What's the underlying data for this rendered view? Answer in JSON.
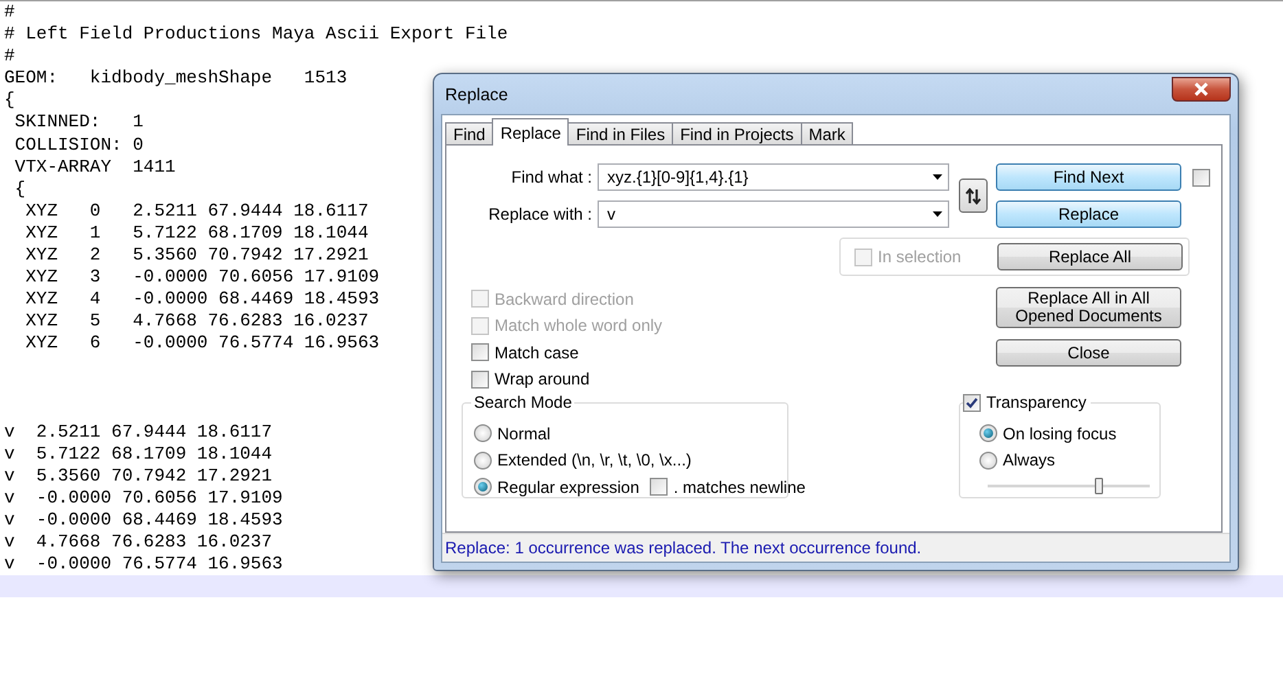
{
  "editor": {
    "sections": [
      {
        "lines": [
          "#",
          "# Left Field Productions Maya Ascii Export File",
          "#",
          "GEOM:   kidbody_meshShape   1513",
          "{",
          " SKINNED:   1",
          " COLLISION: 0",
          " VTX-ARRAY  1411",
          " {",
          "  XYZ   0   2.5211 67.9444 18.6117",
          "  XYZ   1   5.7122 68.1709 18.1044",
          "  XYZ   2   5.3560 70.7942 17.2921",
          "  XYZ   3   -0.0000 70.6056 17.9109",
          "  XYZ   4   -0.0000 68.4469 18.4593",
          "  XYZ   5   4.7668 76.6283 16.0237",
          "  XYZ   6   -0.0000 76.5774 16.9563"
        ]
      },
      {
        "lines": [
          "v  2.5211 67.9444 18.6117",
          "v  5.7122 68.1709 18.1044",
          "v  5.3560 70.7942 17.2921",
          "v  -0.0000 70.6056 17.9109",
          "v  -0.0000 68.4469 18.4593",
          "v  4.7668 76.6283 16.0237",
          "v  -0.0000 76.5774 16.9563"
        ]
      }
    ]
  },
  "dialog": {
    "title": "Replace",
    "tabs": [
      {
        "label": "Find",
        "selected": false
      },
      {
        "label": "Replace",
        "selected": true
      },
      {
        "label": "Find in Files",
        "selected": false
      },
      {
        "label": "Find in Projects",
        "selected": false
      },
      {
        "label": "Mark",
        "selected": false
      }
    ],
    "fields": [
      {
        "label": "Find what :",
        "value": "xyz.{1}[0-9]{1,4}.{1}"
      },
      {
        "label": "Replace with :",
        "value": "v"
      }
    ],
    "buttons": [
      {
        "label": "Find Next",
        "highlighted": true
      },
      {
        "label": "Replace",
        "highlighted": true
      },
      {
        "label": "Replace All",
        "highlighted": false
      },
      {
        "label": "Replace All in All Opened Documents",
        "highlighted": false
      },
      {
        "label": "Close",
        "highlighted": false
      }
    ],
    "side_checkbox": {
      "checked": false
    },
    "in_selection": {
      "label": "In selection",
      "checked": false,
      "disabled": true
    },
    "options": [
      {
        "label": "Backward direction",
        "checked": false,
        "disabled": true
      },
      {
        "label": "Match whole word only",
        "checked": false,
        "disabled": true
      },
      {
        "label": "Match case",
        "checked": false,
        "disabled": false
      },
      {
        "label": "Wrap around",
        "checked": false,
        "disabled": false
      }
    ],
    "search_mode": {
      "title": "Search Mode",
      "modes": [
        {
          "label": "Normal",
          "selected": false
        },
        {
          "label": "Extended (\\n, \\r, \\t, \\0, \\x...)",
          "selected": false
        },
        {
          "label": "Regular expression",
          "selected": true
        }
      ],
      "dot_newline": {
        "label": ". matches newline",
        "checked": false
      }
    },
    "transparency": {
      "label": "Transparency",
      "checked": true,
      "modes": [
        {
          "label": "On losing focus",
          "selected": true
        },
        {
          "label": "Always",
          "selected": false
        }
      ],
      "level": 0.69
    },
    "status": "Replace: 1 occurrence was replaced. The next occurrence found."
  }
}
